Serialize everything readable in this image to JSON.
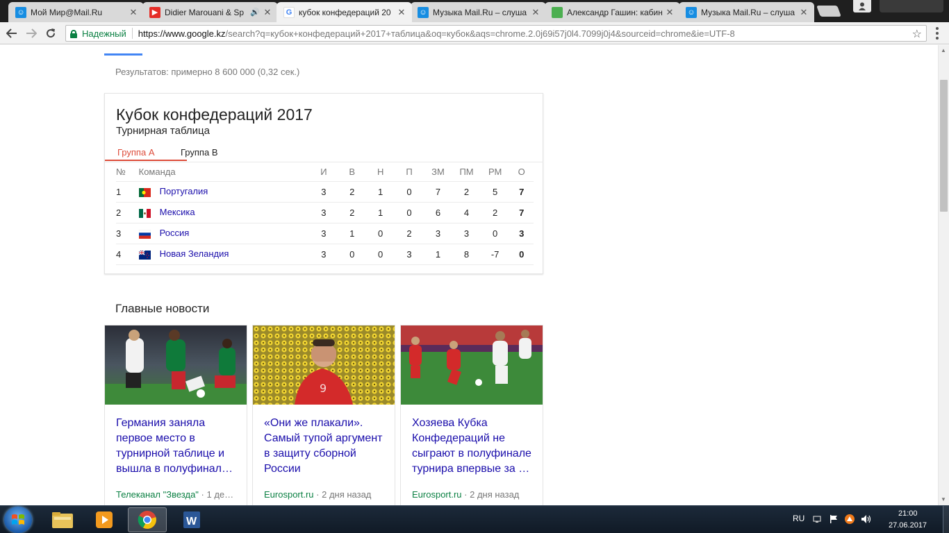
{
  "browser": {
    "tabs": [
      {
        "title": "Мой Мир@Mail.Ru",
        "icon": "mailru-icon",
        "active": false
      },
      {
        "title": "Didier Marouani & Sp",
        "icon": "youtube-icon",
        "active": false
      },
      {
        "title": "кубок конфедераций 20",
        "icon": "google-icon",
        "active": true
      },
      {
        "title": "Музыка Mail.Ru – слуша",
        "icon": "mailru-icon",
        "active": false
      },
      {
        "title": "Александр Гашин: кабин",
        "icon": "green-page-icon",
        "active": false
      },
      {
        "title": "Музыка Mail.Ru – слуша",
        "icon": "mailru-icon",
        "active": false
      }
    ],
    "secure_label": "Надежный",
    "url_main": "https://www.google.kz",
    "url_rest": "/search?q=кубок+конфедераций+2017+таблица&oq=кубок&aqs=chrome.2.0j69i57j0l4.7099j0j4&sourceid=chrome&ie=UTF-8"
  },
  "results_text": "Результатов: примерно 8 600 000 (0,32 сек.)",
  "standings": {
    "title": "Кубок конфедераций 2017",
    "subtitle": "Турнирная таблица",
    "groups": [
      "Группа A",
      "Группа B"
    ],
    "headers": [
      "№",
      "Команда",
      "И",
      "В",
      "Н",
      "П",
      "ЗМ",
      "ПМ",
      "РМ",
      "О"
    ],
    "rows": [
      {
        "pos": "1",
        "team": "Португалия",
        "flag": "portugal",
        "p": "3",
        "w": "2",
        "d": "1",
        "l": "0",
        "gf": "7",
        "ga": "2",
        "gd": "5",
        "pts": "7"
      },
      {
        "pos": "2",
        "team": "Мексика",
        "flag": "mexico",
        "p": "3",
        "w": "2",
        "d": "1",
        "l": "0",
        "gf": "6",
        "ga": "4",
        "gd": "2",
        "pts": "7"
      },
      {
        "pos": "3",
        "team": "Россия",
        "flag": "russia",
        "p": "3",
        "w": "1",
        "d": "0",
        "l": "2",
        "gf": "3",
        "ga": "3",
        "gd": "0",
        "pts": "3"
      },
      {
        "pos": "4",
        "team": "Новая Зеландия",
        "flag": "new-zealand",
        "p": "3",
        "w": "0",
        "d": "0",
        "l": "3",
        "gf": "1",
        "ga": "8",
        "gd": "-7",
        "pts": "0"
      }
    ]
  },
  "news": {
    "heading": "Главные новости",
    "items": [
      {
        "title": "Германия заняла первое место в турнирной таблице и вышла в полуфинал…",
        "source": "Телеканал \"Звезда\"",
        "time": " · 1 де…"
      },
      {
        "title": "«Они же плакали». Самый тупой аргумент в защиту сборной России",
        "source": "Eurosport.ru",
        "time": " · 2 дня назад"
      },
      {
        "title": "Хозяева Кубка Конфедераций не сыграют в полуфинале турнира впервые за …",
        "source": "Eurosport.ru",
        "time": " · 2 дня назад"
      }
    ]
  },
  "taskbar": {
    "lang": "RU",
    "time": "21:00",
    "date": "27.06.2017"
  },
  "colors": {
    "link": "#1a0dab",
    "source_green": "#0b8043",
    "group_active": "#dd4b39",
    "google_blue": "#4285f4"
  }
}
